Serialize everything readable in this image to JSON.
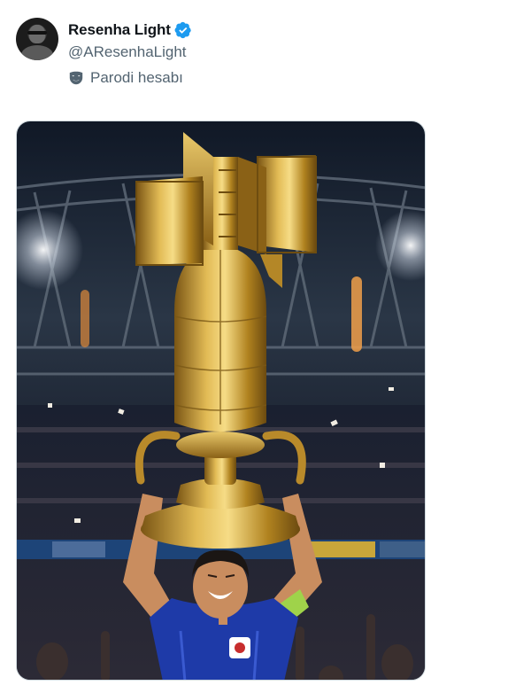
{
  "tweet": {
    "author": {
      "display_name": "Resenha Light",
      "handle": "@AResenhaLight",
      "verified": true,
      "verified_color": "#1d9bf0"
    },
    "label": {
      "icon": "theater-mask-icon",
      "text": "Parodi hesabı"
    },
    "media": {
      "kind": "image",
      "icon": "photo",
      "subject": "player lifting bomb-shaped gold trophy",
      "colors": {
        "sky": "#1c2636",
        "gold": "#c79a2c",
        "kit": "#1e3aa8",
        "armband": "#9fd34a"
      }
    }
  }
}
